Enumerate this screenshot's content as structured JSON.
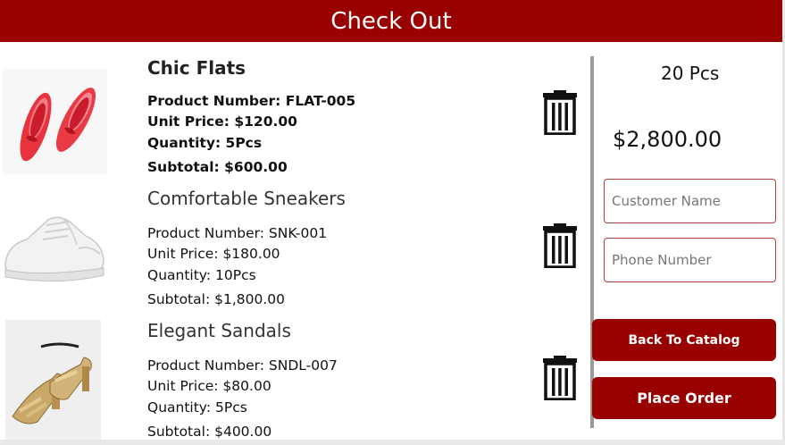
{
  "header": {
    "title": "Check Out"
  },
  "items": [
    {
      "name": "Chic Flats",
      "product_number": "Product Number: FLAT-005",
      "unit_price": "Unit Price: $120.00",
      "quantity": "Quantity: 5Pcs",
      "subtotal": "Subtotal: $600.00",
      "image": "red-ballet-flats-image"
    },
    {
      "name": "Comfortable Sneakers",
      "product_number": "Product Number: SNK-001",
      "unit_price": "Unit Price: $180.00",
      "quantity": "Quantity: 10Pcs",
      "subtotal": "Subtotal: $1,800.00",
      "image": "white-sneaker-image"
    },
    {
      "name": "Elegant Sandals",
      "product_number": "Product Number: SNDL-007",
      "unit_price": "Unit Price: $80.00",
      "quantity": "Quantity: 5Pcs",
      "subtotal": "Subtotal: $400.00",
      "image": "gold-heeled-sandals-image"
    }
  ],
  "summary": {
    "total_quantity": "20 Pcs",
    "total_price": "$2,800.00"
  },
  "form": {
    "customer_name": {
      "value": "",
      "placeholder": "Customer Name"
    },
    "phone_number": {
      "value": "",
      "placeholder": "Phone Number"
    }
  },
  "buttons": {
    "back_to_catalog": "Back To Catalog",
    "place_order": "Place Order"
  },
  "colors": {
    "brand": "#990000",
    "divider": "#9a9a9a"
  }
}
